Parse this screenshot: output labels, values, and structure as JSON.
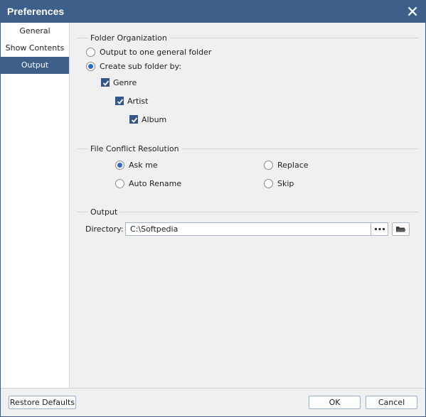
{
  "window": {
    "title": "Preferences"
  },
  "sidebar": {
    "items": [
      {
        "label": "General"
      },
      {
        "label": "Show Contents"
      },
      {
        "label": "Output"
      }
    ],
    "active": "Output"
  },
  "folder_org": {
    "title": "Folder Organization",
    "option_general": "Output to one general folder",
    "option_sub": "Create sub folder by:",
    "selected": "Create sub folder by:",
    "genre": {
      "label": "Genre",
      "checked": true
    },
    "artist": {
      "label": "Artist",
      "checked": true
    },
    "album": {
      "label": "Album",
      "checked": true
    }
  },
  "conflict": {
    "title": "File Conflict Resolution",
    "ask_me": "Ask me",
    "replace": "Replace",
    "auto_rename": "Auto Rename",
    "skip": "Skip",
    "selected": "Ask me"
  },
  "output": {
    "title": "Output",
    "directory_label": "Directory:",
    "directory_value": "C:\\Softpedia"
  },
  "footer": {
    "restore_label": "Restore Defaults",
    "ok_label": "OK",
    "cancel_label": "Cancel"
  },
  "colors": {
    "title_bar": "#3e5f8a",
    "active_nav": "#3e5f8a",
    "radio_dot": "#2e6bc4"
  }
}
